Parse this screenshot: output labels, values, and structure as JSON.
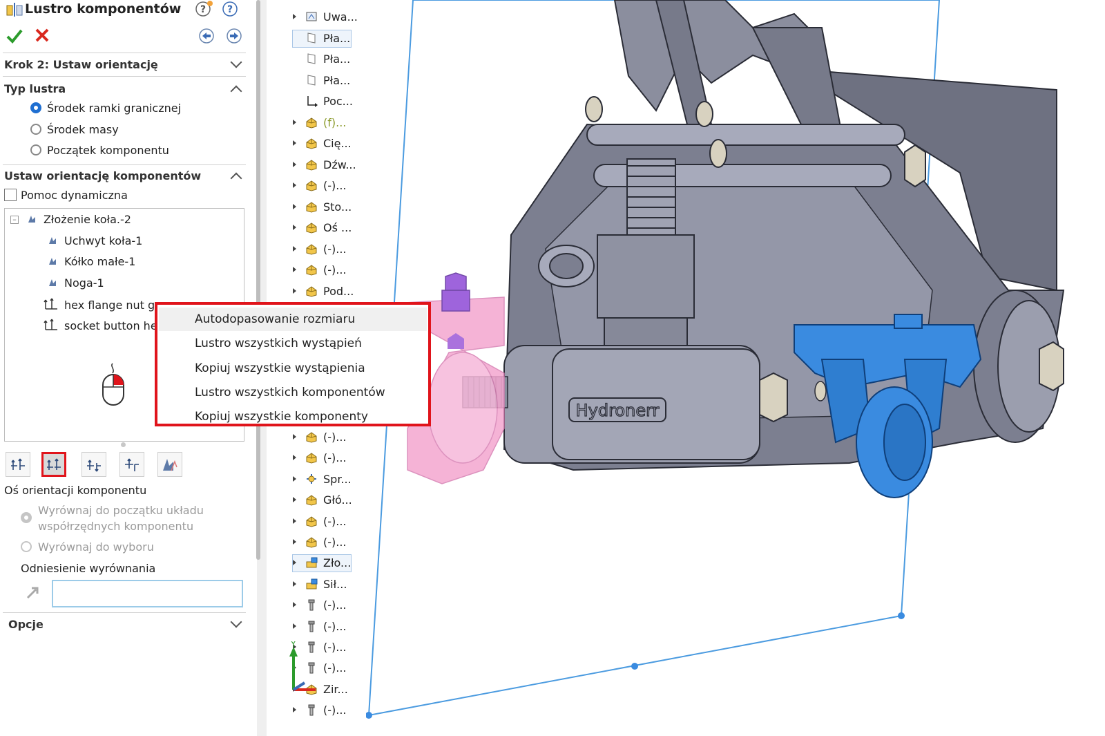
{
  "panel": {
    "title": "Lustro komponentów",
    "step_title": "Krok 2: Ustaw orientację",
    "mirror_type": {
      "header": "Typ lustra",
      "options": [
        {
          "label": "Środek ramki granicznej",
          "selected": true
        },
        {
          "label": "Środek masy",
          "selected": false
        },
        {
          "label": "Początek komponentu",
          "selected": false
        }
      ]
    },
    "orientation": {
      "header": "Ustaw orientację komponentów",
      "dynamic_help_label": "Pomoc dynamiczna",
      "tree": [
        "Złożenie koła.-2",
        "Uchwyt koła-1",
        "Kółko małe-1",
        "Noga-1",
        "hex flange nut gr",
        "socket button hea"
      ],
      "axis_label": "Oś orientacji komponentu",
      "align_origin_line1": "Wyrównaj do początku układu",
      "align_origin_line2": "współrzędnych komponentu",
      "align_selection": "Wyrównaj do wyboru",
      "align_reference_label": "Odniesienie wyrównania",
      "align_reference_value": ""
    },
    "options_header": "Opcje"
  },
  "feature_tree": [
    {
      "label": "Uwa...",
      "icon": "annotations-icon",
      "expandable": true
    },
    {
      "label": "Pła...",
      "icon": "plane-icon",
      "expandable": false,
      "selected": true
    },
    {
      "label": "Pła...",
      "icon": "plane-icon",
      "expandable": false
    },
    {
      "label": "Pła...",
      "icon": "plane-icon",
      "expandable": false
    },
    {
      "label": "Poc...",
      "icon": "origin-icon",
      "expandable": false
    },
    {
      "label": "(f)...",
      "icon": "part-icon",
      "expandable": true,
      "color": "#8a9a2a"
    },
    {
      "label": "Cię...",
      "icon": "part-icon",
      "expandable": true
    },
    {
      "label": "Dźw...",
      "icon": "part-icon",
      "expandable": true
    },
    {
      "label": "(-)...",
      "icon": "part-icon",
      "expandable": true
    },
    {
      "label": "Sto...",
      "icon": "part-icon",
      "expandable": true
    },
    {
      "label": "Oś ...",
      "icon": "part-icon",
      "expandable": true
    },
    {
      "label": "(-)...",
      "icon": "part-icon",
      "expandable": true
    },
    {
      "label": "(-)...",
      "icon": "part-icon",
      "expandable": true
    },
    {
      "label": "Pod...",
      "icon": "part-icon",
      "expandable": true
    },
    {
      "label": "(-)...",
      "icon": "part-icon",
      "expandable": true
    },
    {
      "label": "(-)...",
      "icon": "part-icon",
      "expandable": true
    },
    {
      "label": "Spr...",
      "icon": "spring-icon",
      "expandable": true
    },
    {
      "label": "Głó...",
      "icon": "part-icon",
      "expandable": true
    },
    {
      "label": "(-)...",
      "icon": "part-icon",
      "expandable": true
    },
    {
      "label": "(-)...",
      "icon": "part-icon",
      "expandable": true
    },
    {
      "label": "Zło...",
      "icon": "subassembly-icon",
      "expandable": true,
      "selected": true
    },
    {
      "label": "Sił...",
      "icon": "subassembly-icon",
      "expandable": true
    },
    {
      "label": "(-)...",
      "icon": "bolt-icon",
      "expandable": true
    },
    {
      "label": "(-)...",
      "icon": "bolt-icon",
      "expandable": true
    },
    {
      "label": "(-)...",
      "icon": "bolt-icon",
      "expandable": true
    },
    {
      "label": "(-)...",
      "icon": "bolt-icon",
      "expandable": true
    },
    {
      "label": "Zir...",
      "icon": "part-icon",
      "expandable": true
    },
    {
      "label": "(-)...",
      "icon": "bolt-icon",
      "expandable": true
    }
  ],
  "context_menu": {
    "items": [
      "Autodopasowanie rozmiaru",
      "Lustro wszystkich wystąpień",
      "Kopiuj wszystkie wystąpienia",
      "Lustro wszystkich komponentów",
      "Kopiuj wszystkie komponenty"
    ]
  },
  "viewport": {
    "logo_text": "Hydronerr",
    "triad_y_label": "Y"
  },
  "colors": {
    "accent": "#1f6fd1",
    "highlight_red": "#e0141b",
    "mirror_preview": "#f4a6d0",
    "selected_part": "#3a8be0"
  }
}
